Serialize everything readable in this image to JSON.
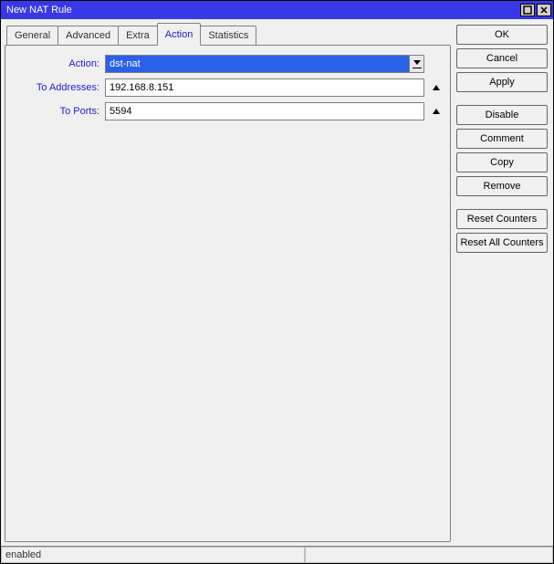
{
  "window": {
    "title": "New NAT Rule"
  },
  "tabs": {
    "general": "General",
    "advanced": "Advanced",
    "extra": "Extra",
    "action": "Action",
    "statistics": "Statistics",
    "active": "Action"
  },
  "form": {
    "action_label": "Action:",
    "action_value": "dst-nat",
    "to_addresses_label": "To Addresses:",
    "to_addresses_value": "192.168.8.151",
    "to_ports_label": "To Ports:",
    "to_ports_value": "5594"
  },
  "buttons": {
    "ok": "OK",
    "cancel": "Cancel",
    "apply": "Apply",
    "disable": "Disable",
    "comment": "Comment",
    "copy": "Copy",
    "remove": "Remove",
    "reset_counters": "Reset Counters",
    "reset_all_counters": "Reset All Counters"
  },
  "status": {
    "text": "enabled"
  }
}
